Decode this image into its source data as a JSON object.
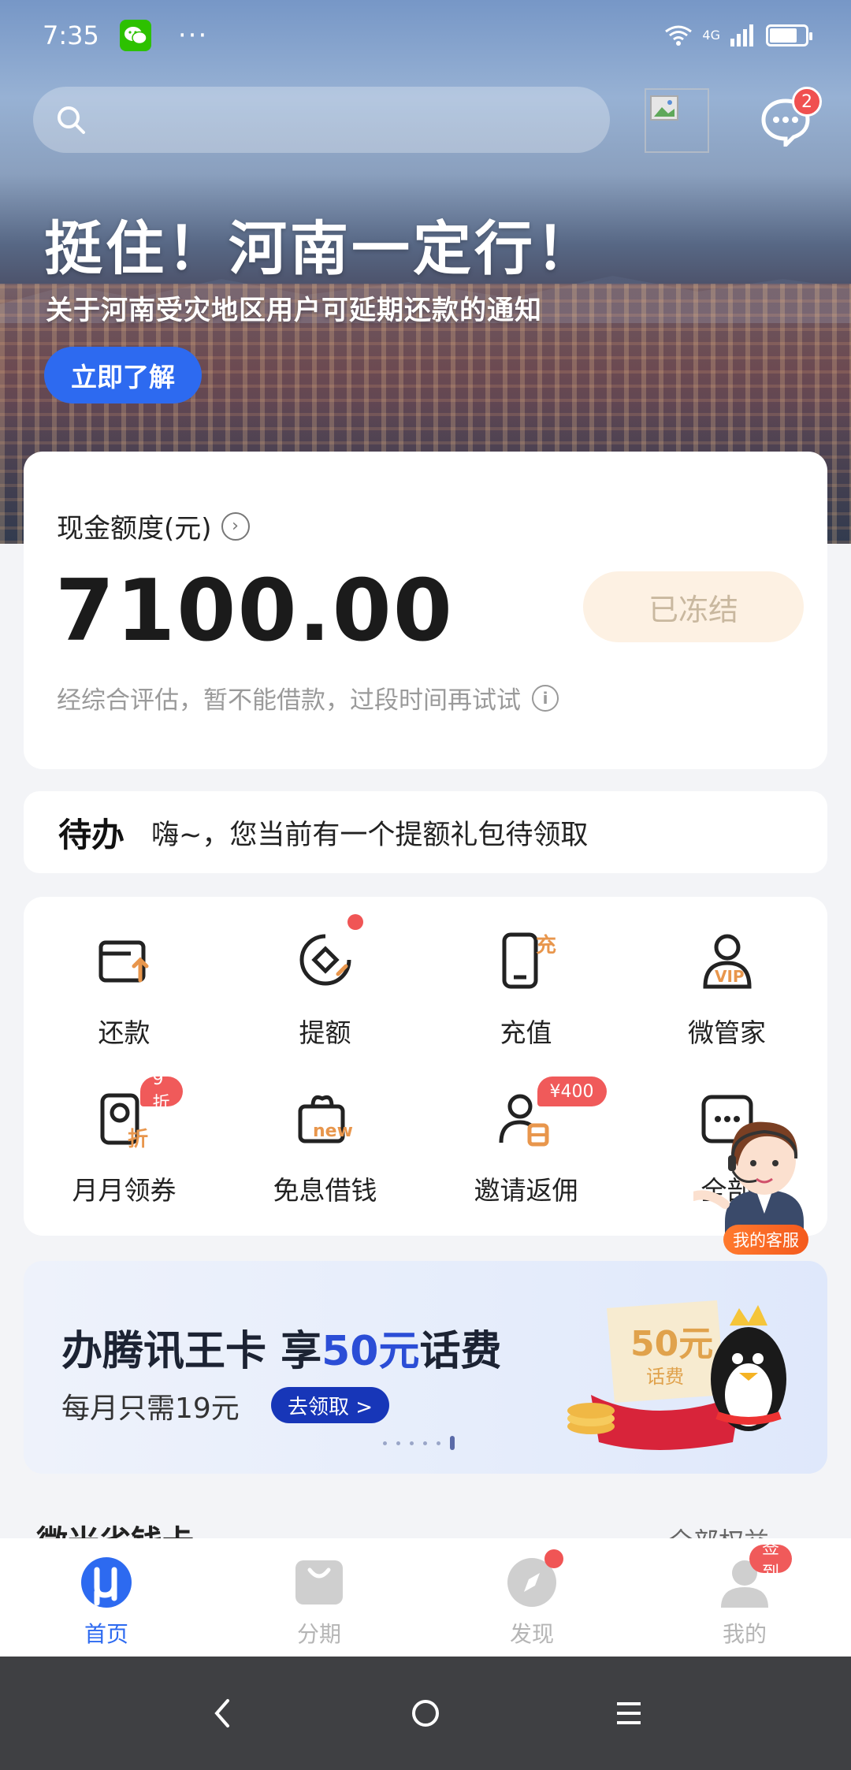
{
  "status_bar": {
    "time": "7:35",
    "dots": "···",
    "network": "4G"
  },
  "header": {
    "message_count": "2"
  },
  "hero": {
    "title": "挺住！河南一定行！",
    "subtitle": "关于河南受灾地区用户可延期还款的通知",
    "cta": "立即了解"
  },
  "credit": {
    "label": "现金额度(元)",
    "amount": "7100.00",
    "status": "已冻结",
    "note": "经综合评估，暂不能借款，过段时间再试试"
  },
  "todo": {
    "tag": "待办",
    "message": "嗨~，您当前有一个提额礼包待领取"
  },
  "services": [
    {
      "label": "还款",
      "icon": "repay-icon"
    },
    {
      "label": "提额",
      "icon": "raise-limit-icon"
    },
    {
      "label": "充值",
      "icon": "recharge-icon"
    },
    {
      "label": "微管家",
      "icon": "vip-steward-icon"
    },
    {
      "label": "月月领券",
      "icon": "monthly-coupon-icon",
      "badge": "9折"
    },
    {
      "label": "免息借钱",
      "icon": "interest-free-icon"
    },
    {
      "label": "邀请返佣",
      "icon": "invite-icon",
      "badge": "¥400"
    },
    {
      "label": "全部",
      "icon": "all-icon"
    }
  ],
  "customer_service": {
    "label": "我的客服"
  },
  "promo": {
    "title_a": "办腾讯王卡 享",
    "title_hl": "50元",
    "title_b": "话费",
    "subtitle": "每月只需19元",
    "button": "去领取 >",
    "art_amount": "50元",
    "art_note": "话费"
  },
  "section": {
    "title": "微米省钱卡",
    "more": "全部权益"
  },
  "tabbar": {
    "tabs": [
      {
        "label": "首页",
        "active": true
      },
      {
        "label": "分期",
        "active": false
      },
      {
        "label": "发现",
        "active": false
      },
      {
        "label": "我的",
        "active": false,
        "badge": "签到"
      }
    ]
  },
  "colors": {
    "accent": "#2d6af0",
    "badge_red": "#f05555",
    "frozen_bg": "#fdf1e3"
  }
}
